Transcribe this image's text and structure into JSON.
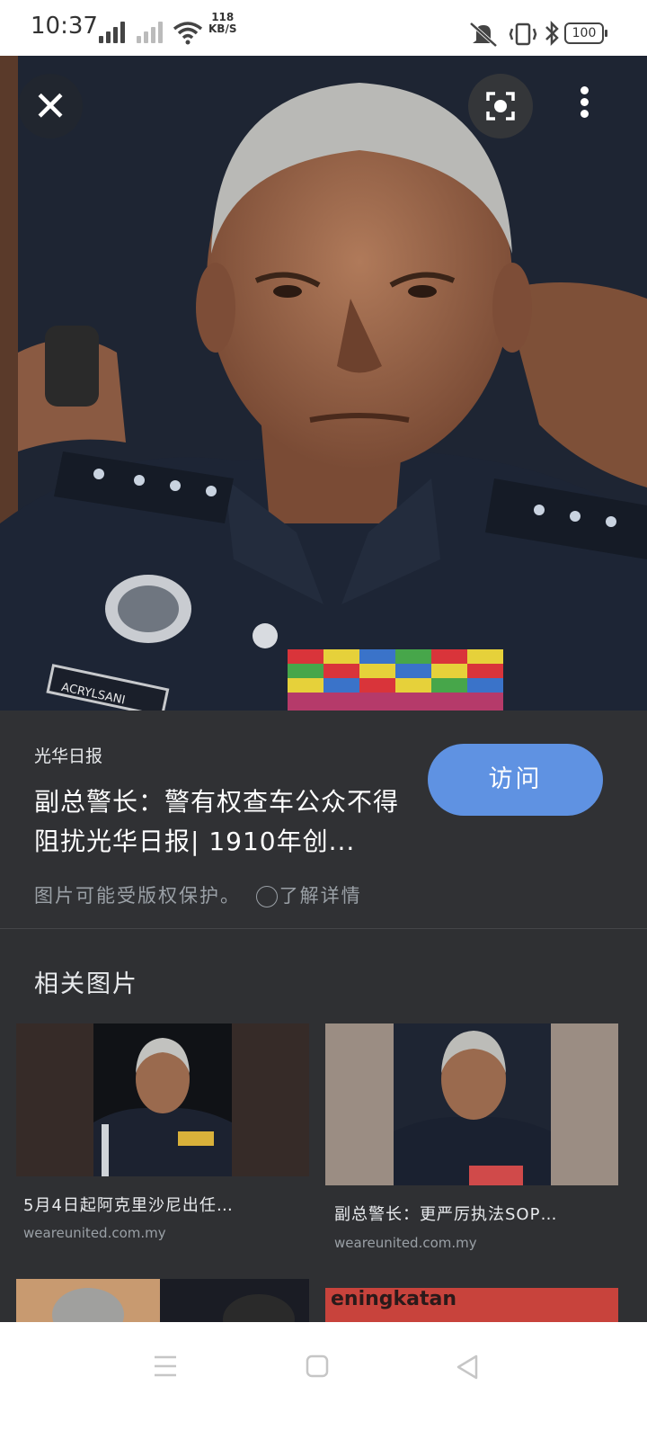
{
  "status_bar": {
    "time": "10:37",
    "net_rate_value": "118",
    "net_rate_unit": "KB/S",
    "battery": "100"
  },
  "image_viewer": {
    "close_icon": "close-icon",
    "lens_icon": "google-lens-icon",
    "more_icon": "more-vert-icon",
    "name_tag_text": "ACRYLSANI"
  },
  "result": {
    "source": "光华日报",
    "title": "副总警长：警有权查车公众不得阻扰光华日报| 1910年创...",
    "visit_label": "访问",
    "copyright_text": "图片可能受版权保护。",
    "learn_more": "了解详情"
  },
  "related": {
    "heading": "相关图片",
    "items": [
      {
        "title": "5月4日起阿克里沙尼出任…",
        "site": "weareunited.com.my"
      },
      {
        "title": "副总警长：更严厉执法SOP…",
        "site": "weareunited.com.my"
      },
      {
        "partial_text": "eningkatan"
      }
    ]
  },
  "colors": {
    "panel": "#303134",
    "accent": "#5f92e2",
    "muted": "#9aa0a6"
  }
}
